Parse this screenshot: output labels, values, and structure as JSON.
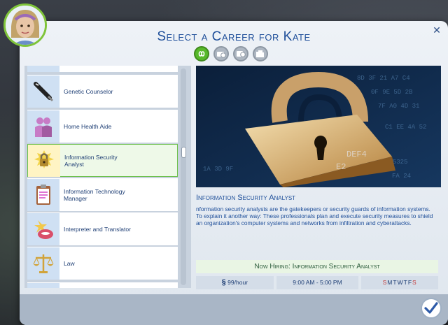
{
  "dialog": {
    "title": "Select a Career for Kate",
    "close_icon": "close-icon"
  },
  "filters": [
    {
      "name": "all-filter",
      "icon": "infinity-icon",
      "active": true
    },
    {
      "name": "full-time-filter",
      "icon": "briefcase-clock-icon",
      "active": false
    },
    {
      "name": "part-time-filter",
      "icon": "clock-icon",
      "active": false
    },
    {
      "name": "other-filter",
      "icon": "folder-icon",
      "active": false
    }
  ],
  "career_list": {
    "items": [
      {
        "label": "Genetic Counselor",
        "icon": "pen-icon"
      },
      {
        "label": "Home Health Aide",
        "icon": "people-icon"
      },
      {
        "label": "Information Security Analyst",
        "icon": "padlock-icon",
        "selected": true
      },
      {
        "label": "Information Technology Manager",
        "icon": "clipboard-icon"
      },
      {
        "label": "Interpreter and Translator",
        "icon": "speech-icon"
      },
      {
        "label": "Law",
        "icon": "scales-icon"
      }
    ]
  },
  "detail": {
    "title": "Information Security Analyst",
    "description": "nformation security analysts are the gatekeepers or security guards of information systems. To explain it another way: These professionals plan and execute security measures to shield an organization's computer systems and networks from infiltration and cyberattacks.",
    "hiring": "Now Hiring: Information Security Analyst",
    "pay_symbol": "§",
    "pay": "99/hour",
    "hours": "9:00 AM - 5:00 PM",
    "days_letters": [
      "S",
      "M",
      "T",
      "W",
      "T",
      "F",
      "S"
    ],
    "days_active": [
      true,
      false,
      false,
      false,
      false,
      false,
      true
    ]
  },
  "footer": {
    "confirm_icon": "checkmark-icon"
  }
}
